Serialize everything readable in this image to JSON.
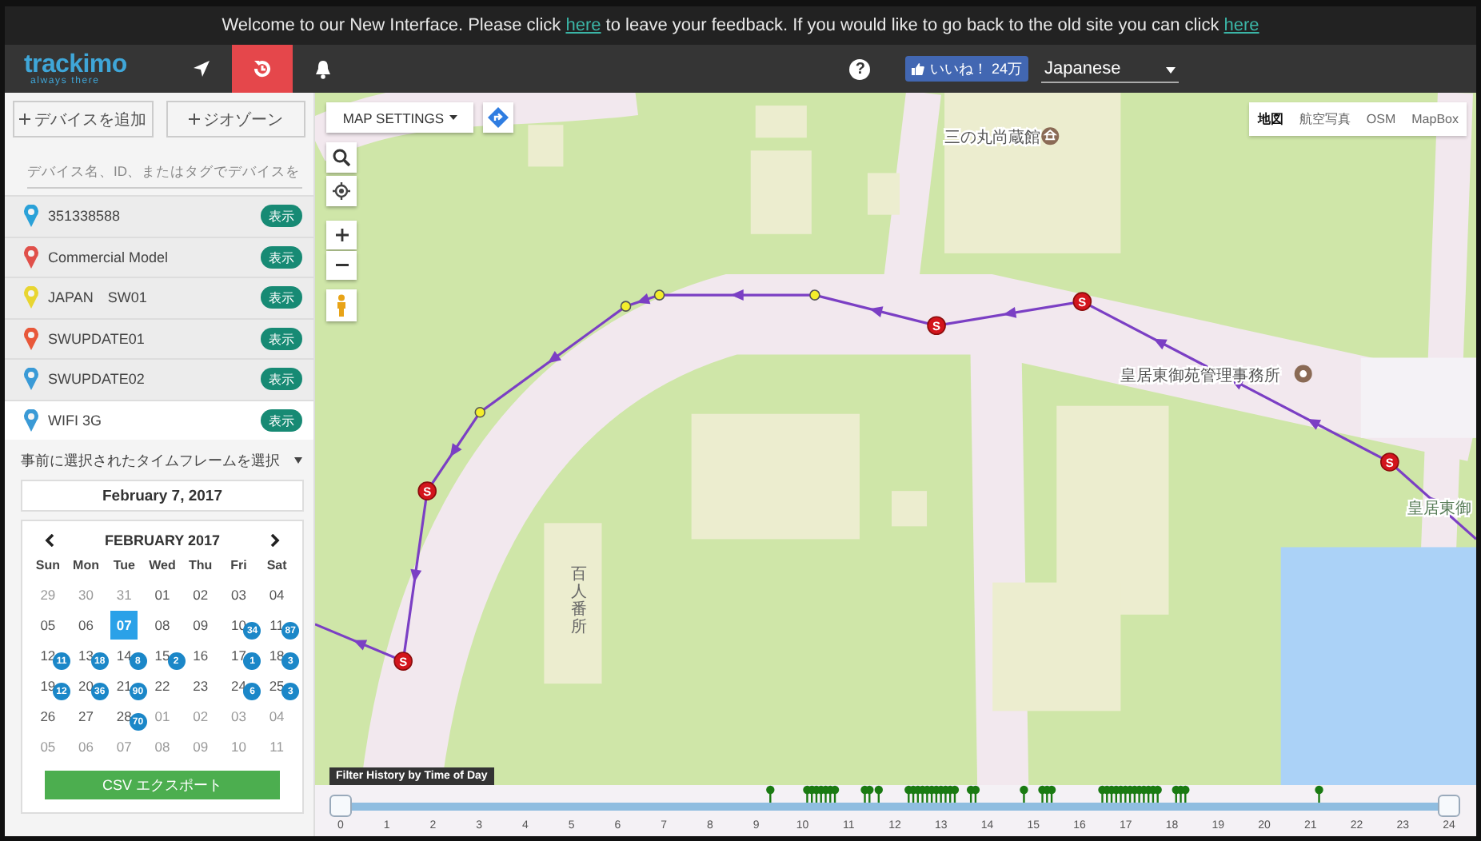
{
  "banner": {
    "parts": [
      {
        "kind": "text",
        "text": "Welcome to our New Interface. Please click "
      },
      {
        "kind": "link",
        "text": "here"
      },
      {
        "kind": "text",
        "text": " to leave your feedback. If you would like to go back to the old site you can click "
      },
      {
        "kind": "link",
        "text": "here"
      }
    ]
  },
  "nav": {
    "help": "?",
    "logo": "trackimo",
    "tagline": "always there",
    "items": [
      {
        "kind": "navigate",
        "selected": false
      },
      {
        "kind": "history",
        "selected": true
      },
      {
        "kind": "alerts",
        "selected": false
      }
    ],
    "like_button": {
      "label": "いいね！",
      "count": "24万"
    },
    "language": "Japanese"
  },
  "sidebar": {
    "buttons": [
      "デバイスを追加",
      "ジオゾーン"
    ],
    "search": {
      "placeholder": "デバイス名、ID、またはタグでデバイスを"
    },
    "devices": [
      {
        "name": "351338588",
        "color": "#2aa1d8",
        "action": "表示",
        "selected": false
      },
      {
        "name": "Commercial Model",
        "color": "#e0504a",
        "action": "表示",
        "selected": false
      },
      {
        "name": "JAPAN　SW01",
        "color": "#e8d531",
        "action": "表示",
        "selected": false
      },
      {
        "name": "SWUPDATE01",
        "color": "#e8583a",
        "action": "表示",
        "selected": false
      },
      {
        "name": "SWUPDATE02",
        "color": "#3a9ad6",
        "action": "表示",
        "selected": false
      },
      {
        "name": "WIFI 3G",
        "color": "#3a9ad6",
        "action": "表示",
        "selected": true
      }
    ],
    "timeframe": "事前に選択されたタイムフレームを選択",
    "date": "February 7, 2017",
    "calendar": {
      "month": "FEBRUARY 2017",
      "weekdays": [
        "Sun",
        "Mon",
        "Tue",
        "Wed",
        "Thu",
        "Fri",
        "Sat"
      ],
      "weeks": [
        [
          {
            "day": "29",
            "muted": true
          },
          {
            "day": "30",
            "muted": true
          },
          {
            "day": "31",
            "muted": true
          },
          {
            "day": "01",
            "muted": false
          },
          {
            "day": "02",
            "muted": false
          },
          {
            "day": "03",
            "muted": false
          },
          {
            "day": "04",
            "muted": false
          }
        ],
        [
          {
            "day": "05",
            "muted": false
          },
          {
            "day": "06",
            "muted": false
          },
          {
            "day": "07",
            "muted": false,
            "selected": true
          },
          {
            "day": "08",
            "muted": false
          },
          {
            "day": "09",
            "muted": false
          },
          {
            "day": "10",
            "muted": false,
            "count": "34"
          },
          {
            "day": "11",
            "muted": false,
            "count": "87"
          }
        ],
        [
          {
            "day": "12",
            "muted": false,
            "count": "11"
          },
          {
            "day": "13",
            "muted": false,
            "count": "18"
          },
          {
            "day": "14",
            "muted": false,
            "count": "8"
          },
          {
            "day": "15",
            "muted": false,
            "count": "2"
          },
          {
            "day": "16",
            "muted": false
          },
          {
            "day": "17",
            "muted": false,
            "count": "1"
          },
          {
            "day": "18",
            "muted": false,
            "count": "3"
          }
        ],
        [
          {
            "day": "19",
            "muted": false,
            "count": "12"
          },
          {
            "day": "20",
            "muted": false,
            "count": "36"
          },
          {
            "day": "21",
            "muted": false,
            "count": "90"
          },
          {
            "day": "22",
            "muted": false
          },
          {
            "day": "23",
            "muted": false
          },
          {
            "day": "24",
            "muted": false,
            "count": "6"
          },
          {
            "day": "25",
            "muted": false,
            "count": "3"
          }
        ],
        [
          {
            "day": "26",
            "muted": false
          },
          {
            "day": "27",
            "muted": false
          },
          {
            "day": "28",
            "muted": false,
            "count": "70"
          },
          {
            "day": "01",
            "muted": true
          },
          {
            "day": "02",
            "muted": true
          },
          {
            "day": "03",
            "muted": true
          },
          {
            "day": "04",
            "muted": true
          }
        ],
        [
          {
            "day": "05",
            "muted": true
          },
          {
            "day": "06",
            "muted": true
          },
          {
            "day": "07",
            "muted": true
          },
          {
            "day": "08",
            "muted": true
          },
          {
            "day": "09",
            "muted": true
          },
          {
            "day": "10",
            "muted": true
          },
          {
            "day": "11",
            "muted": true
          }
        ]
      ]
    },
    "export_button": "CSV エクスポート"
  },
  "map": {
    "settings_button": "MAP SETTINGS",
    "map_types": [
      {
        "label": "地図",
        "selected": true
      },
      {
        "label": "航空写真",
        "selected": false
      },
      {
        "label": "OSM",
        "selected": false
      },
      {
        "label": "MapBox",
        "selected": false
      }
    ],
    "labels": [
      "三の丸尚蔵館",
      "皇居東御苑管理事務所",
      "皇居東御",
      "百人番所"
    ],
    "stops": [
      {
        "label": "S"
      },
      {
        "label": "S"
      },
      {
        "label": "S"
      },
      {
        "label": "S"
      },
      {
        "label": "S"
      }
    ],
    "timeline": {
      "title": "Filter History by Time of Day",
      "ticks": [
        "0",
        "1",
        "2",
        "3",
        "4",
        "5",
        "6",
        "7",
        "8",
        "9",
        "10",
        "11",
        "12",
        "13",
        "14",
        "15",
        "16",
        "17",
        "18",
        "19",
        "20",
        "21",
        "22",
        "23",
        "24"
      ],
      "handles": [
        {
          "level": 0
        },
        {
          "level": 1
        }
      ]
    }
  }
}
